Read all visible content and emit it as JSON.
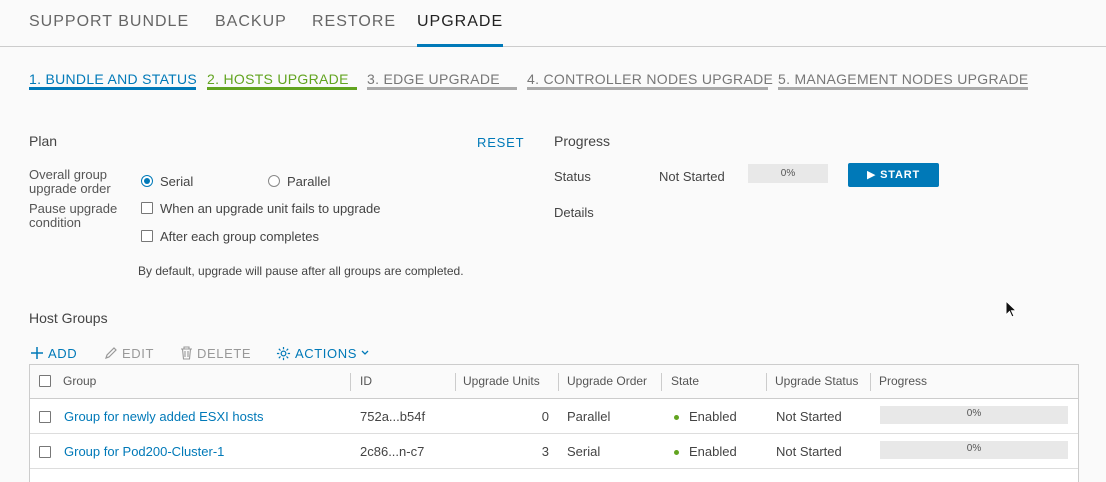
{
  "top_tabs": [
    "SUPPORT BUNDLE",
    "BACKUP",
    "RESTORE",
    "UPGRADE"
  ],
  "steps": [
    "1. BUNDLE AND STATUS",
    "2. HOSTS UPGRADE",
    "3. EDGE UPGRADE",
    "4. CONTROLLER NODES UPGRADE",
    "5. MANAGEMENT NODES UPGRADE"
  ],
  "plan": {
    "title": "Plan",
    "reset_label": "RESET",
    "order_label": "Overall group upgrade order",
    "serial_label": "Serial",
    "parallel_label": "Parallel",
    "selected_order": "Serial",
    "pause_label": "Pause upgrade condition",
    "pause_fail_label": "When an upgrade unit fails to upgrade",
    "pause_group_label": "After each group completes",
    "note": "By default, upgrade will pause after all groups are completed."
  },
  "progress": {
    "title": "Progress",
    "status_label": "Status",
    "status_value": "Not Started",
    "percent_text": "0%",
    "percent": 0,
    "details_label": "Details",
    "start_label": "▶ START"
  },
  "host_groups": {
    "title": "Host Groups",
    "toolbar": {
      "add": "ADD",
      "edit": "EDIT",
      "delete": "DELETE",
      "actions": "ACTIONS"
    },
    "columns": [
      "Group",
      "ID",
      "Upgrade Units",
      "Upgrade Order",
      "State",
      "Upgrade Status",
      "Progress"
    ],
    "rows": [
      {
        "group": "Group for newly added ESXI hosts",
        "id": "752a...b54f",
        "units": "0",
        "order": "Parallel",
        "state": "Enabled",
        "status": "Not Started",
        "progress_text": "0%",
        "progress": 0
      },
      {
        "group": "Group for Pod200-Cluster-1",
        "id": "2c86...n-c7",
        "units": "3",
        "order": "Serial",
        "state": "Enabled",
        "status": "Not Started",
        "progress_text": "0%",
        "progress": 0
      }
    ]
  },
  "colors": {
    "accent": "#0079b8",
    "success": "#62a420"
  }
}
